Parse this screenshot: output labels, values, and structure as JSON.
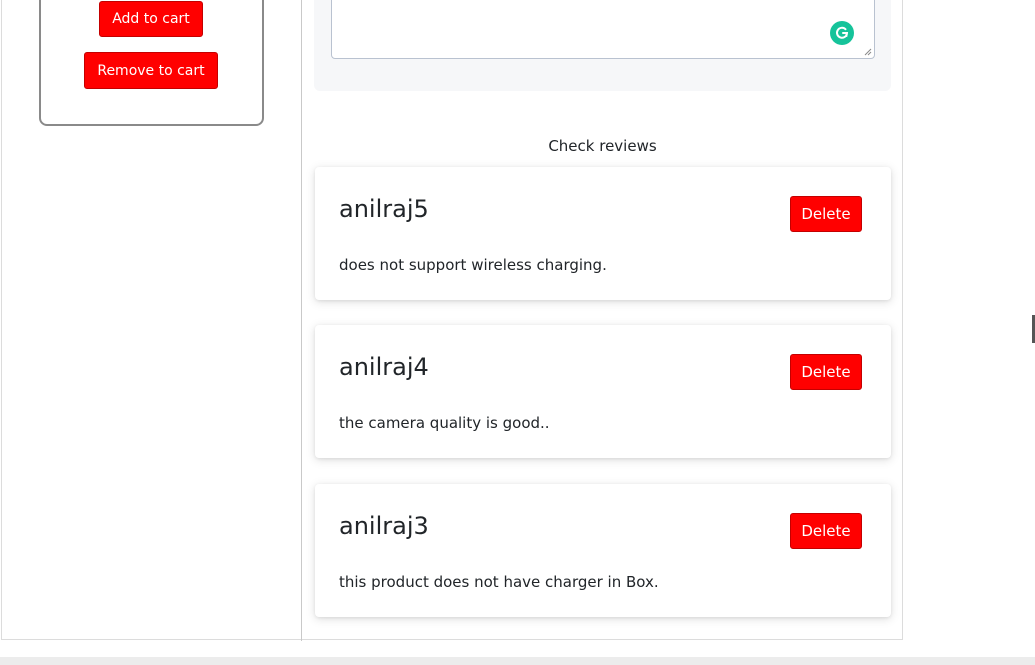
{
  "product": {
    "add_to_cart_label": "Add to cart",
    "remove_label": "Remove to cart"
  },
  "reviews_section": {
    "heading": "Check reviews",
    "delete_label": "Delete",
    "items": [
      {
        "author": "anilraj5",
        "text": "does not support wireless charging."
      },
      {
        "author": "anilraj4",
        "text": "the camera quality is good.."
      },
      {
        "author": "anilraj3",
        "text": "this product does not have charger in Box."
      }
    ]
  },
  "icons": {
    "grammarly": "grammarly-icon",
    "accent": "#15c39a",
    "button_color": "#ff0000"
  }
}
